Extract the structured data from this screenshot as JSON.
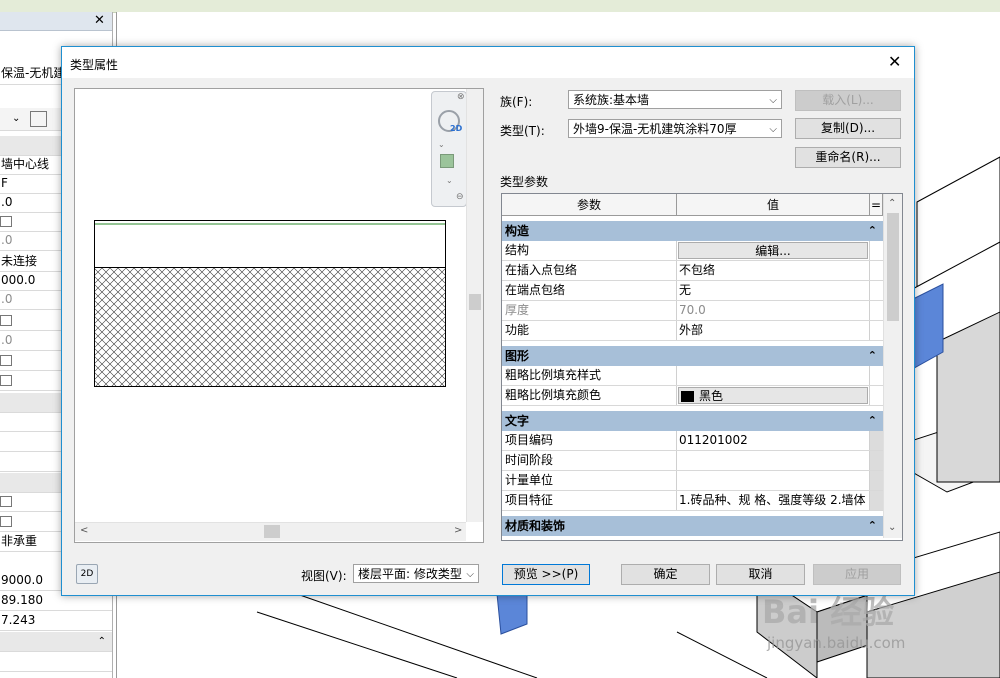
{
  "dialog": {
    "title": "类型属性",
    "close_glyph": "✕",
    "family_label": "族(F):",
    "family_value": "系统族:基本墙",
    "type_label": "类型(T):",
    "type_value": "外墙9-保温-无机建筑涂料70厚",
    "load_button": "载入(L)...",
    "duplicate_button": "复制(D)...",
    "rename_button": "重命名(R)...",
    "type_params_label": "类型参数",
    "view_label": "视图(V):",
    "view_value": "楼层平面: 修改类型",
    "preview_button": "预览 >>(P)",
    "ok_button": "确定",
    "cancel_button": "取消",
    "apply_button": "应用",
    "view2d_glyph": "2D"
  },
  "table": {
    "header_param": "参数",
    "header_value": "值",
    "header_extra": "=",
    "sections": [
      {
        "title": "构造",
        "rows": [
          {
            "param": "结构",
            "value": "编辑...",
            "kind": "button"
          },
          {
            "param": "在插入点包络",
            "value": "不包络"
          },
          {
            "param": "在端点包络",
            "value": "无"
          },
          {
            "param": "厚度",
            "value": "70.0",
            "kind": "disabled"
          },
          {
            "param": "功能",
            "value": "外部"
          }
        ]
      },
      {
        "title": "图形",
        "rows": [
          {
            "param": "粗略比例填充样式",
            "value": ""
          },
          {
            "param": "粗略比例填充颜色",
            "value": "黑色",
            "kind": "color"
          }
        ]
      },
      {
        "title": "文字",
        "rows": [
          {
            "param": "项目编码",
            "value": "011201002"
          },
          {
            "param": "时间阶段",
            "value": ""
          },
          {
            "param": "计量单位",
            "value": ""
          },
          {
            "param": "项目特征",
            "value": "1.砖品种、规 格、强度等级 2.墙体"
          }
        ]
      },
      {
        "title": "材质和装饰",
        "rows": []
      }
    ]
  },
  "left_panel": {
    "close_glyph": "✕",
    "type_title": "保温-无机建筑",
    "rows": [
      "墙中心线",
      "F",
      ".0",
      "",
      ".0",
      "未连接",
      "000.0",
      ".0",
      "",
      ".0",
      "",
      "",
      "",
      "",
      "",
      "",
      "",
      "非承重",
      "9000.0",
      "89.180",
      "7.243",
      "",
      ""
    ]
  },
  "watermark": {
    "main": "Bai 经验",
    "sub": "jingyan.baidu.com"
  }
}
